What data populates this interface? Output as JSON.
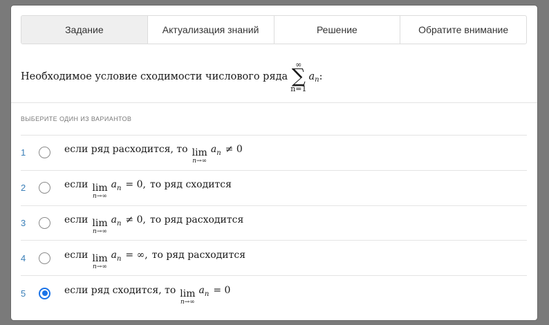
{
  "tabs": [
    {
      "label": "Задание",
      "active": true
    },
    {
      "label": "Актуализация знаний",
      "active": false
    },
    {
      "label": "Решение",
      "active": false
    },
    {
      "label": "Обратите внимание",
      "active": false
    }
  ],
  "question": {
    "text": "Необходимое условие сходимости числового ряда",
    "sum_upper": "∞",
    "sum_symbol": "∑",
    "sum_lower": "n=1",
    "term": "a",
    "term_sub": "n",
    "end": ":"
  },
  "hint": "ВЫБЕРИТЕ ОДИН ИЗ ВАРИАНТОВ",
  "options": [
    {
      "num": "1",
      "before": "если ряд расходится, то",
      "lim_word": "lim",
      "lim_under": "n→∞",
      "term": "a",
      "term_sub": "n",
      "relation": "≠ 0",
      "after": "",
      "selected": false
    },
    {
      "num": "2",
      "before": "если",
      "lim_word": "lim",
      "lim_under": "n→∞",
      "term": "a",
      "term_sub": "n",
      "relation": "= 0,",
      "after": "то ряд сходится",
      "selected": false
    },
    {
      "num": "3",
      "before": "если",
      "lim_word": "lim",
      "lim_under": "n→∞",
      "term": "a",
      "term_sub": "n",
      "relation": "≠ 0,",
      "after": "то ряд расходится",
      "selected": false
    },
    {
      "num": "4",
      "before": "если",
      "lim_word": "lim",
      "lim_under": "n→∞",
      "term": "a",
      "term_sub": "n",
      "relation": "= ∞,",
      "after": "то ряд расходится",
      "selected": false
    },
    {
      "num": "5",
      "before": "если ряд сходится, то",
      "lim_word": "lim",
      "lim_under": "n→∞",
      "term": "a",
      "term_sub": "n",
      "relation": "= 0",
      "after": "",
      "selected": true
    }
  ],
  "colors": {
    "accent": "#1a73e8",
    "number": "#3a7fb8",
    "active_tab": "#efefef"
  }
}
